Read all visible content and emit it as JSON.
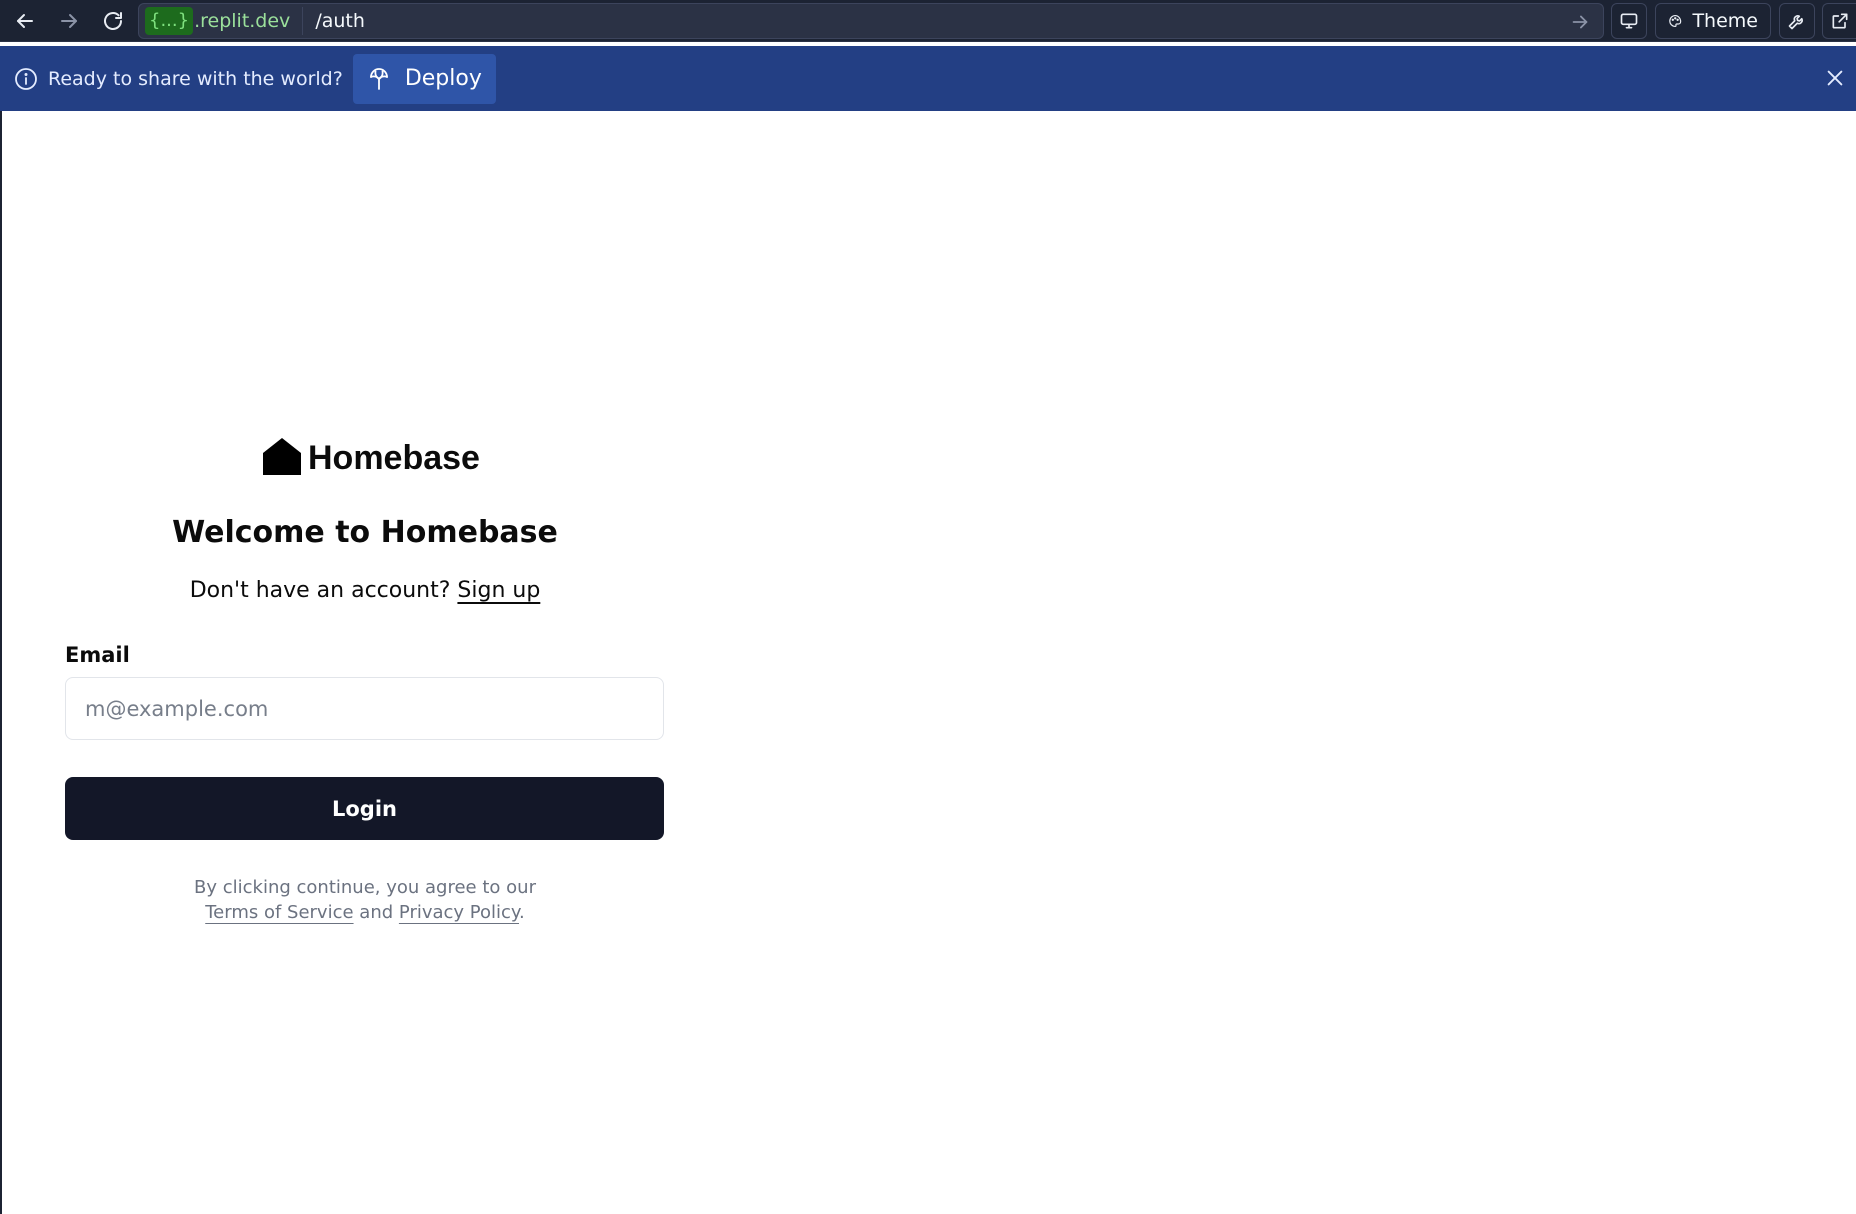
{
  "browser": {
    "url_redacted": "{...}",
    "url_host": ".replit.dev",
    "url_path": "/auth",
    "theme_label": "Theme"
  },
  "banner": {
    "message": "Ready to share with the world?",
    "deploy_label": "Deploy",
    "color": "#233f84"
  },
  "brand": {
    "name": "Homebase"
  },
  "auth": {
    "title": "Welcome to Homebase",
    "signup_prompt": "Don't have an account?",
    "signup_link": "Sign up",
    "email_label": "Email",
    "email_placeholder": "m@example.com",
    "email_value": "",
    "login_label": "Login",
    "legal_prefix": "By clicking continue, you agree to our",
    "terms_link": "Terms of Service",
    "legal_and": "and",
    "privacy_link": "Privacy Policy",
    "legal_suffix": "."
  },
  "icons": {
    "back": "arrow-left-icon",
    "forward": "arrow-right-icon",
    "reload": "reload-icon",
    "go": "arrow-right-small-icon",
    "devices": "monitor-icon",
    "theme": "palette-icon",
    "devtools": "wrench-icon",
    "new_tab": "external-link-icon",
    "info": "info-icon",
    "deploy": "deploy-icon",
    "close": "close-icon",
    "logo": "house-icon"
  }
}
